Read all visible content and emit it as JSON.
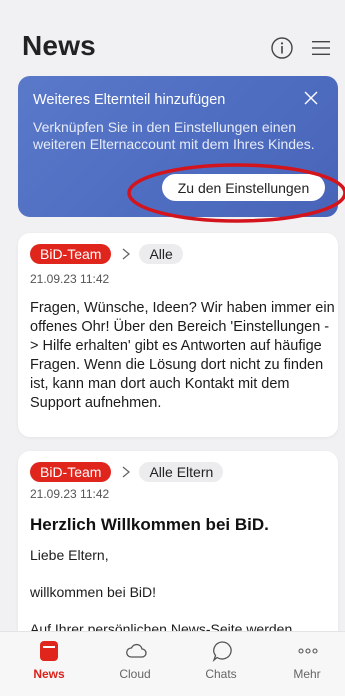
{
  "header": {
    "title": "News"
  },
  "promo": {
    "title": "Weiteres Elternteil hinzufügen",
    "text": "Verknüpfen Sie in den Einstellungen einen weiteren Elternaccount mit dem Ihres Kindes.",
    "cta": "Zu den Einstellungen"
  },
  "posts": [
    {
      "author": "BiD-Team",
      "audience": "Alle",
      "date": "21.09.23 11:42",
      "body": "Fragen, Wünsche, Ideen? Wir haben immer ein offenes Ohr! Über den Bereich 'Einstellungen -> Hilfe erhalten' gibt es Antworten auf häufige Fragen. Wenn die Lösung dort nicht zu finden ist, kann man dort auch Kontakt mit dem Support aufnehmen."
    },
    {
      "author": "BiD-Team",
      "audience": "Alle Eltern",
      "date": "21.09.23 11:42",
      "title": "Herzlich Willkommen bei BiD.",
      "p1": "Liebe Eltern,",
      "p2": "willkommen bei BiD!",
      "p3": "Auf Ihrer persönlichen News-Seite werden"
    }
  ],
  "tabs": [
    {
      "label": "News",
      "icon": "news-icon",
      "active": true
    },
    {
      "label": "Cloud",
      "icon": "cloud-icon",
      "active": false
    },
    {
      "label": "Chats",
      "icon": "chat-bubble-icon",
      "active": false
    },
    {
      "label": "Mehr",
      "icon": "more-dots-icon",
      "active": false
    }
  ],
  "colors": {
    "accent": "#e0251d",
    "promo": "#5270c4",
    "highlight_ring": "#d3141c"
  }
}
